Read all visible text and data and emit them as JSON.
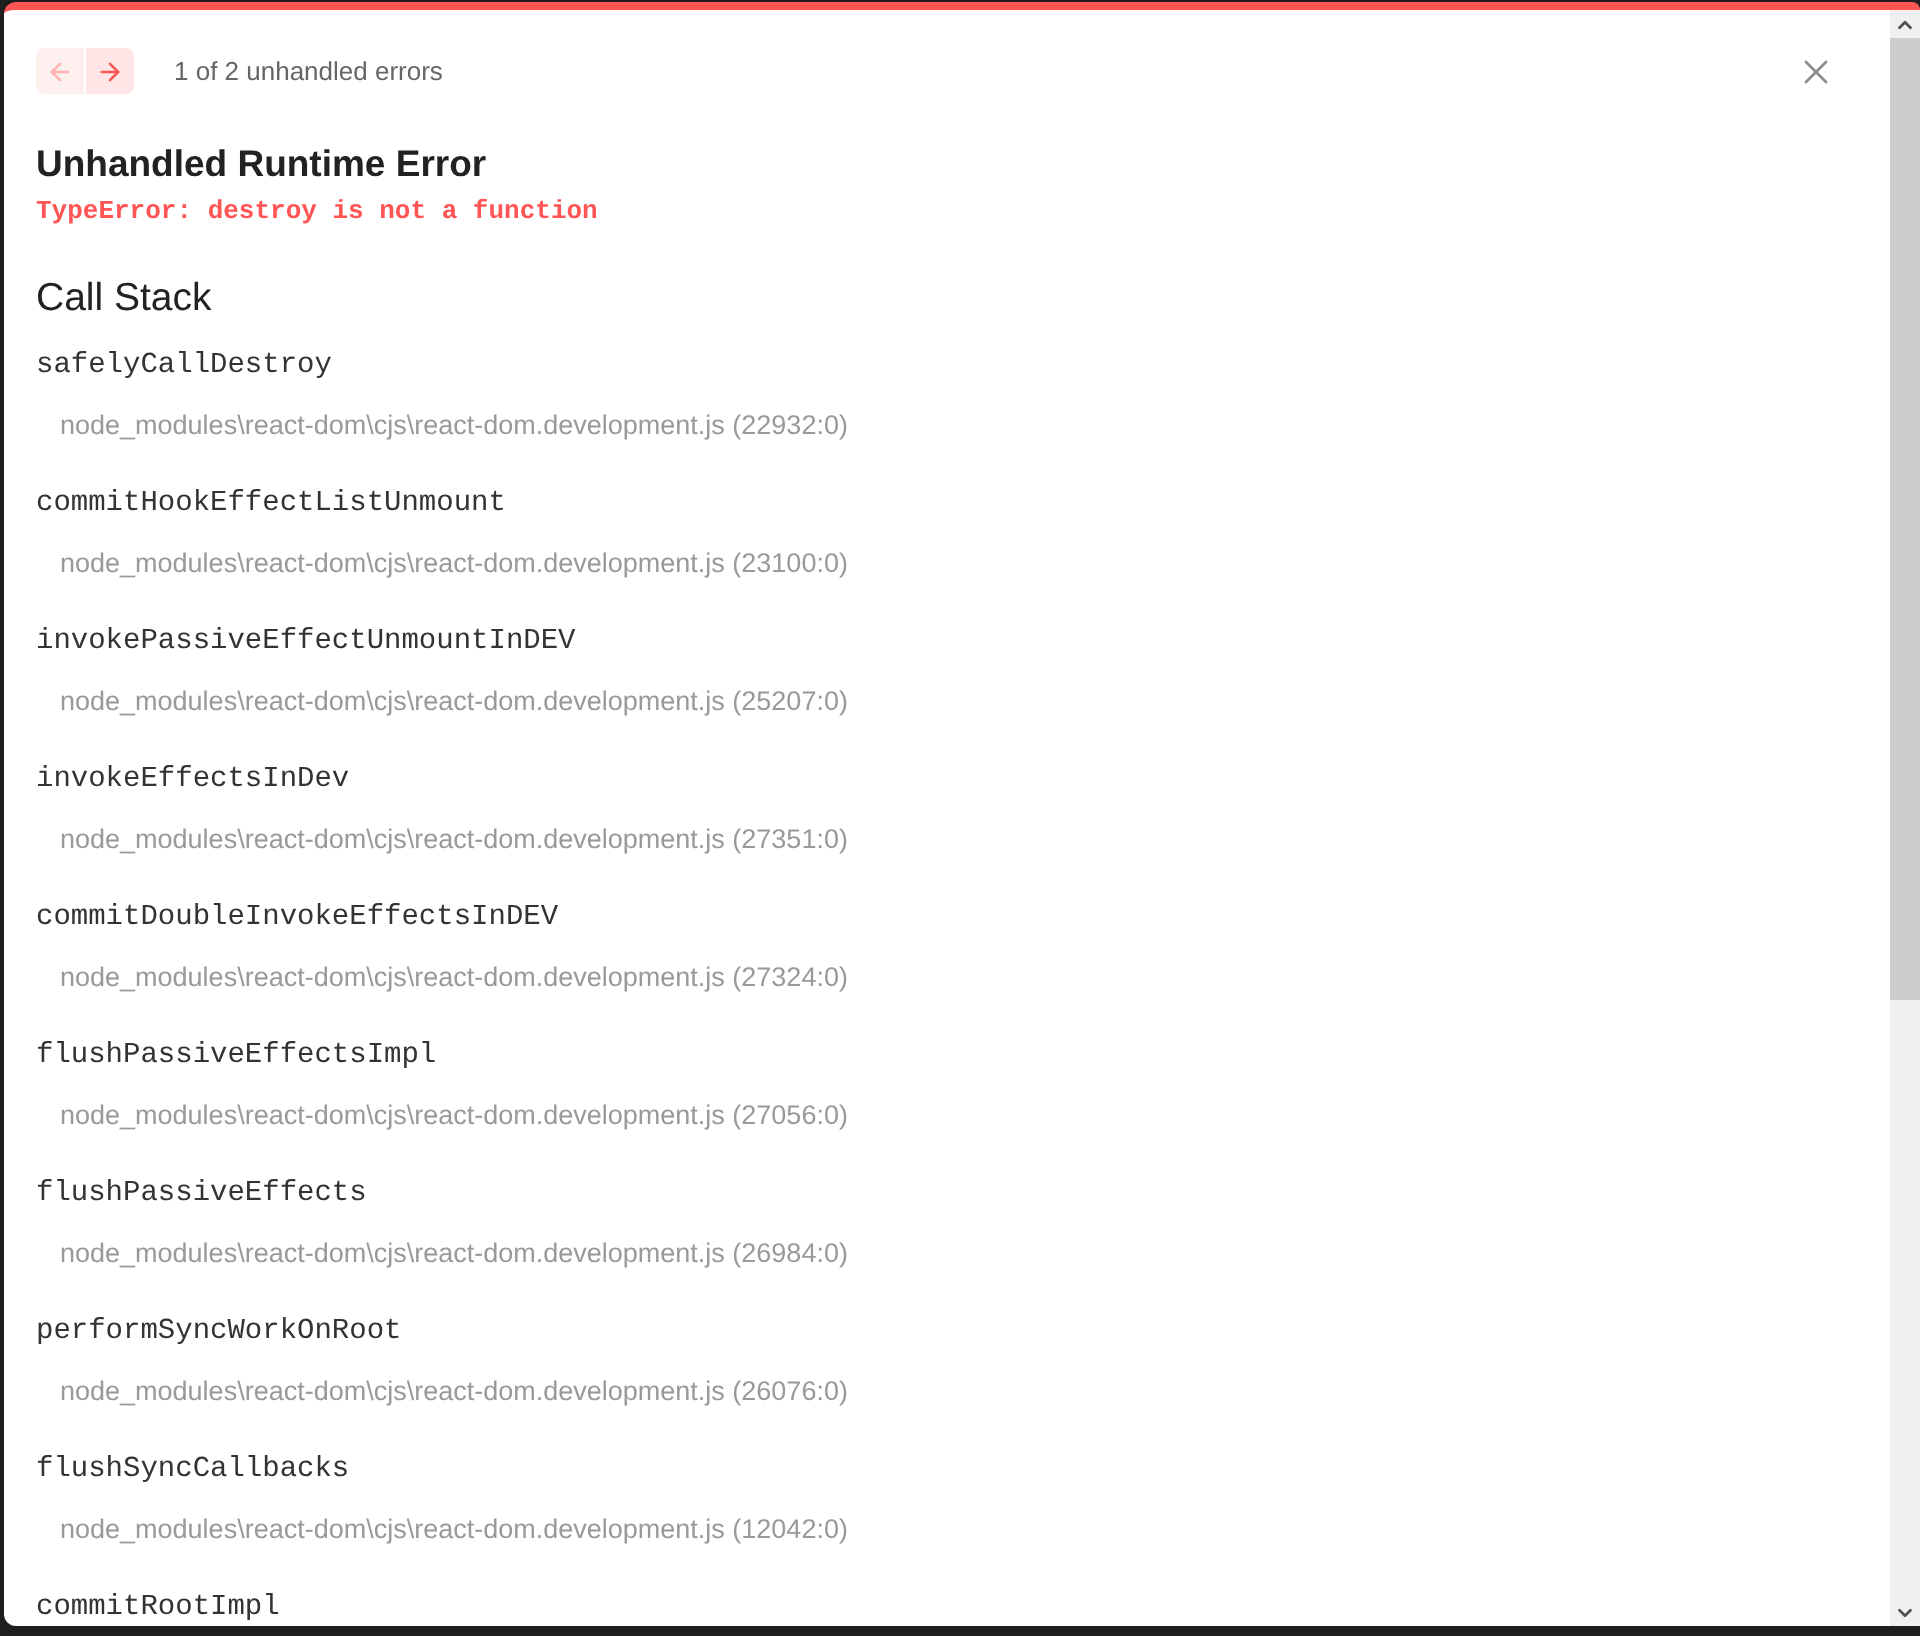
{
  "nav": {
    "buttons": [
      {
        "kind": "prev",
        "disabled": true
      },
      {
        "kind": "next",
        "disabled": false
      }
    ],
    "count": "1 of 2 unhandled errors"
  },
  "error": {
    "title": "Unhandled Runtime Error",
    "message": "TypeError: destroy is not a function"
  },
  "call_stack": {
    "heading": "Call Stack",
    "frames": [
      {
        "name": "safelyCallDestroy",
        "location": "node_modules\\react-dom\\cjs\\react-dom.development.js (22932:0)"
      },
      {
        "name": "commitHookEffectListUnmount",
        "location": "node_modules\\react-dom\\cjs\\react-dom.development.js (23100:0)"
      },
      {
        "name": "invokePassiveEffectUnmountInDEV",
        "location": "node_modules\\react-dom\\cjs\\react-dom.development.js (25207:0)"
      },
      {
        "name": "invokeEffectsInDev",
        "location": "node_modules\\react-dom\\cjs\\react-dom.development.js (27351:0)"
      },
      {
        "name": "commitDoubleInvokeEffectsInDEV",
        "location": "node_modules\\react-dom\\cjs\\react-dom.development.js (27324:0)"
      },
      {
        "name": "flushPassiveEffectsImpl",
        "location": "node_modules\\react-dom\\cjs\\react-dom.development.js (27056:0)"
      },
      {
        "name": "flushPassiveEffects",
        "location": "node_modules\\react-dom\\cjs\\react-dom.development.js (26984:0)"
      },
      {
        "name": "performSyncWorkOnRoot",
        "location": "node_modules\\react-dom\\cjs\\react-dom.development.js (26076:0)"
      },
      {
        "name": "flushSyncCallbacks",
        "location": "node_modules\\react-dom\\cjs\\react-dom.development.js (12042:0)"
      },
      {
        "name": "commitRootImpl"
      }
    ]
  }
}
